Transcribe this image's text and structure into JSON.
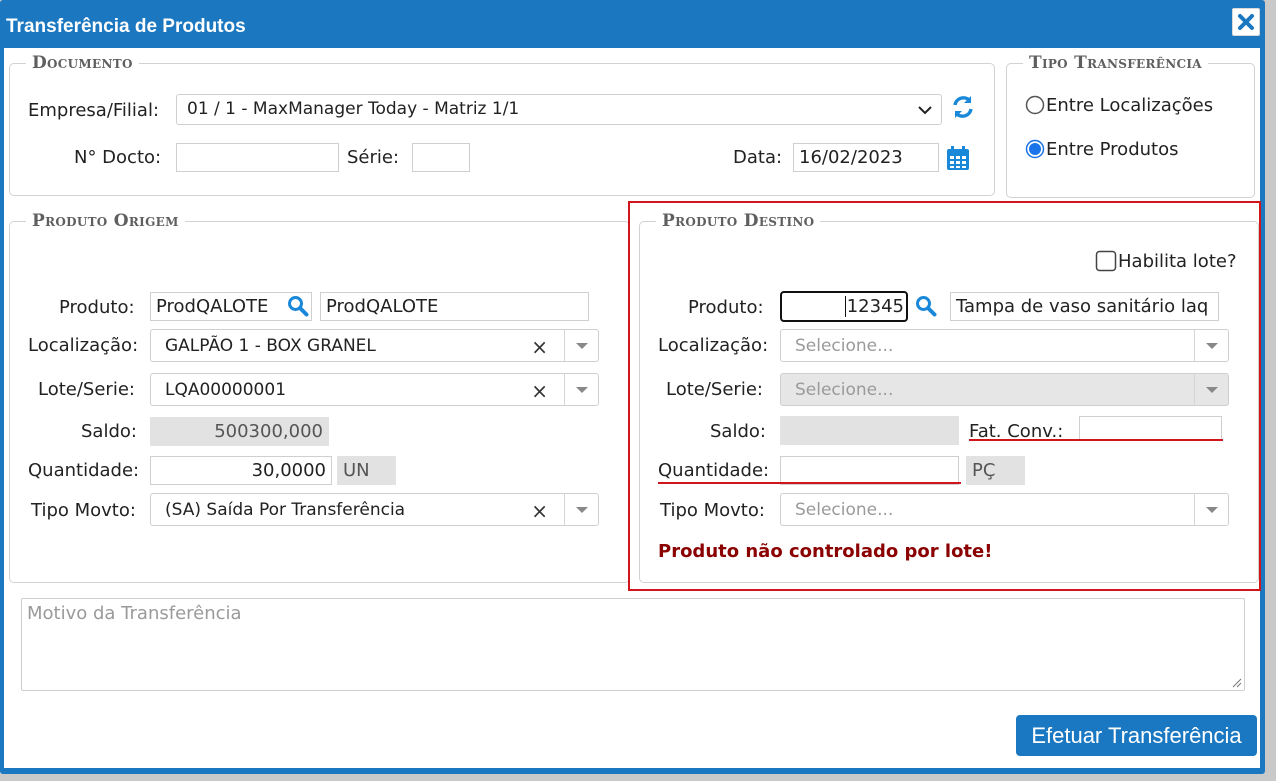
{
  "window": {
    "title": "Transferência de Produtos"
  },
  "documento": {
    "legend": "Documento",
    "empresa_label": "Empresa/Filial:",
    "empresa_value": "01 / 1 - MaxManager Today - Matriz 1/1",
    "docto_label": "N° Docto:",
    "docto_value": "",
    "serie_label": "Série:",
    "serie_value": "",
    "data_label": "Data:",
    "data_value": "16/02/2023"
  },
  "tipo": {
    "legend": "Tipo Transferência",
    "option1": "Entre Localizações",
    "option2": "Entre Produtos",
    "selected": "Entre Produtos"
  },
  "origem": {
    "legend": "Produto Origem",
    "produto_label": "Produto:",
    "produto_code": "ProdQALOTE",
    "produto_desc": "ProdQALOTE",
    "localizacao_label": "Localização:",
    "localizacao_value": "GALPÃO 1 - BOX GRANEL",
    "lote_label": "Lote/Serie:",
    "lote_value": "LQA00000001",
    "saldo_label": "Saldo:",
    "saldo_value": "500300,000",
    "quantidade_label": "Quantidade:",
    "quantidade_value": "30,0000",
    "unidade": "UN",
    "tipo_movto_label": "Tipo Movto:",
    "tipo_movto_value": "(SA) Saída Por Transferência"
  },
  "destino": {
    "legend": "Produto Destino",
    "habilita_lote_label": "Habilita lote?",
    "produto_label": "Produto:",
    "produto_code": "12345",
    "produto_desc": "Tampa de vaso sanitário laq",
    "localizacao_label": "Localização:",
    "localizacao_placeholder": "Selecione...",
    "lote_label": "Lote/Serie:",
    "lote_placeholder": "Selecione...",
    "saldo_label": "Saldo:",
    "saldo_value": "",
    "fat_conv_label": "Fat. Conv.:",
    "fat_conv_value": "",
    "quantidade_label": "Quantidade:",
    "quantidade_value": "",
    "unidade": "PÇ",
    "tipo_movto_label": "Tipo Movto:",
    "tipo_movto_placeholder": "Selecione...",
    "error_message": "Produto não controlado por lote!"
  },
  "motivo": {
    "placeholder": "Motivo da Transferência"
  },
  "actions": {
    "submit_label": "Efetuar Transferência"
  },
  "colors": {
    "title_bar": "#1b78c0",
    "primary_button": "#1a78c2",
    "error_text": "#8b0000",
    "highlight_border": "#d0161b",
    "icon_blue": "#1a88d8"
  }
}
